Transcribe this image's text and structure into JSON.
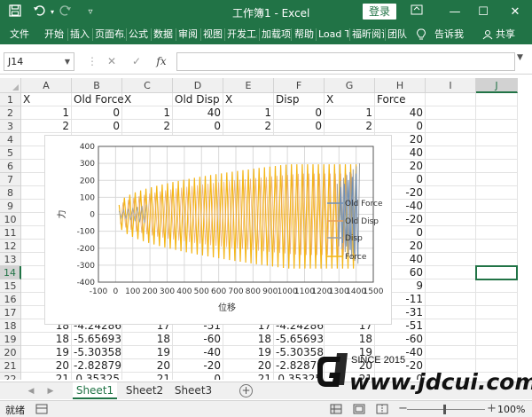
{
  "window": {
    "title": "工作簿1  -  Excel",
    "login_label": "登录"
  },
  "ribbon": {
    "tabs": [
      "文件",
      "开始",
      "插入",
      "页面布局",
      "公式",
      "数据",
      "审阅",
      "视图",
      "开发工具",
      "加载项",
      "帮助",
      "Load Test",
      "福昕阅读器",
      "团队"
    ],
    "tell_me": "告诉我",
    "share": "共享"
  },
  "formula_bar": {
    "name_box": "J14",
    "fx_label": "fx",
    "formula": ""
  },
  "columns": [
    "A",
    "B",
    "C",
    "D",
    "E",
    "F",
    "G",
    "H",
    "I",
    "J"
  ],
  "rows": [
    [
      "X",
      "Old Force",
      "X",
      "Old Disp",
      "X",
      "Disp",
      "X",
      "Force"
    ],
    [
      "1",
      "0",
      "1",
      "40",
      "1",
      "0",
      "1",
      "40"
    ],
    [
      "2",
      "0",
      "2",
      "0",
      "2",
      "0",
      "2",
      "0"
    ],
    [
      "",
      "",
      "",
      "",
      "",
      "",
      "",
      "20"
    ],
    [
      "",
      "",
      "",
      "",
      "",
      "",
      "",
      "40"
    ],
    [
      "",
      "",
      "",
      "",
      "",
      "",
      "",
      "20"
    ],
    [
      "",
      "",
      "",
      "",
      "",
      "",
      "",
      "0"
    ],
    [
      "",
      "",
      "",
      "",
      "",
      "",
      "",
      "-20"
    ],
    [
      "",
      "",
      "",
      "",
      "",
      "",
      "",
      "-40"
    ],
    [
      "",
      "",
      "",
      "",
      "",
      "",
      "",
      "-20"
    ],
    [
      "",
      "",
      "",
      "",
      "",
      "",
      "",
      "0"
    ],
    [
      "",
      "",
      "",
      "",
      "",
      "",
      "",
      "20"
    ],
    [
      "",
      "",
      "",
      "",
      "",
      "",
      "",
      "40"
    ],
    [
      "",
      "",
      "",
      "",
      "",
      "",
      "",
      "60"
    ],
    [
      "",
      "",
      "",
      "",
      "",
      "",
      "",
      "9"
    ],
    [
      "",
      "",
      "",
      "",
      "",
      "",
      "",
      "-11"
    ],
    [
      "",
      "",
      "",
      "",
      "",
      "",
      "",
      "-31"
    ],
    [
      "18",
      "-4.24286",
      "17",
      "-51",
      "17",
      "-4.24286",
      "17",
      "-51"
    ],
    [
      "18",
      "-5.65693",
      "18",
      "-60",
      "18",
      "-5.65693",
      "18",
      "-60"
    ],
    [
      "19",
      "-5.30358",
      "19",
      "-40",
      "19",
      "-5.30358",
      "19",
      "-40"
    ],
    [
      "20",
      "-2.82879",
      "20",
      "-20",
      "20",
      "-2.82879",
      "20",
      "-20"
    ],
    [
      "21",
      "0.35325",
      "21",
      "0",
      "21",
      "0.35325",
      "21",
      "0"
    ]
  ],
  "selected_cell": {
    "col": "J",
    "row": "14"
  },
  "chart_data": {
    "type": "line",
    "title": "",
    "xlabel": "位移",
    "ylabel": "力",
    "xlim": [
      -100,
      1500
    ],
    "ylim": [
      -400,
      400
    ],
    "xticks": [
      -100,
      0,
      100,
      200,
      300,
      400,
      500,
      600,
      700,
      800,
      900,
      1000,
      1100,
      1200,
      1300,
      1400,
      1500
    ],
    "yticks": [
      -400,
      -300,
      -200,
      -100,
      0,
      100,
      200,
      300,
      400
    ],
    "grid": true,
    "legend_position": "right",
    "series": [
      {
        "name": "Old Force",
        "color": "#6e8fb8"
      },
      {
        "name": "Old Disp",
        "color": "#e8a15a"
      },
      {
        "name": "Disp",
        "color": "#9aa0a6"
      },
      {
        "name": "Force",
        "color": "#f4b616"
      }
    ],
    "note": "Orange zigzag envelope from x≈20 to x≈1400, amplitude growing from ~50 to ~±300; grey/blue dense oscillation near x≈1300-1420 (±300)"
  },
  "sheets": [
    "Sheet1",
    "Sheet2",
    "Sheet3"
  ],
  "active_sheet": "Sheet1",
  "status": {
    "ready": "就绪",
    "zoom": "100%"
  },
  "watermark": {
    "since": "SINCE 2015",
    "url": "www.jdcui.com"
  }
}
